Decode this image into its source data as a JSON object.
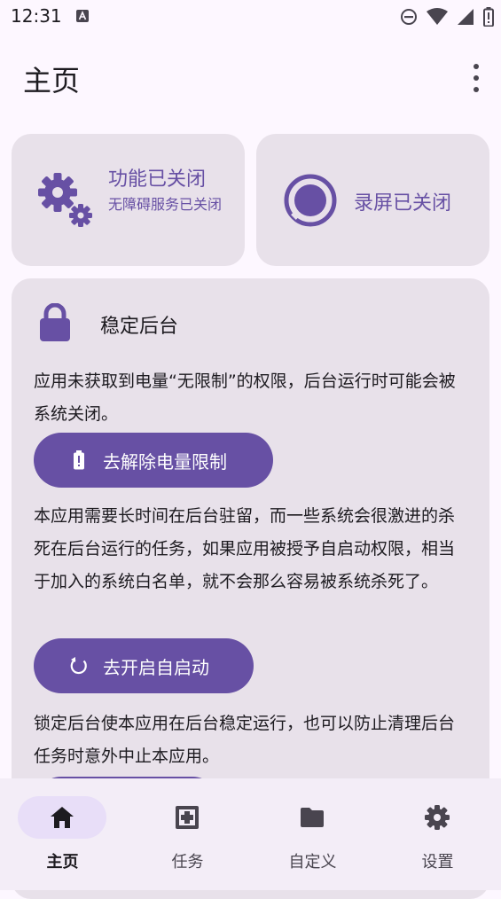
{
  "status_bar": {
    "time": "12:31"
  },
  "app_bar": {
    "title": "主页"
  },
  "cards": {
    "function": {
      "title": "功能已关闭",
      "subtitle": "无障碍服务已关闭"
    },
    "record": {
      "title": "录屏已关闭"
    },
    "stable": {
      "title": "稳定后台",
      "para1": "应用未获取到电量“无限制”的权限，后台运行时可能会被系统关闭。",
      "button1": "去解除电量限制",
      "para2": "本应用需要长时间在后台驻留，而一些系统会很激进的杀死在后台运行的任务，如果应用被授予自启动权限，相当于加入的系统白名单，就不会那么容易被系统杀死了。",
      "button2": "去开启自启动",
      "para3": "锁定后台使本应用在后台稳定运行，也可以防止清理后台任务时意外中止本应用。"
    }
  },
  "nav": [
    {
      "label": "主页",
      "icon": "home-icon",
      "active": true
    },
    {
      "label": "任务",
      "icon": "tasks-icon",
      "active": false
    },
    {
      "label": "自定义",
      "icon": "folder-icon",
      "active": false
    },
    {
      "label": "设置",
      "icon": "settings-icon",
      "active": false
    }
  ],
  "colors": {
    "accent": "#6750a4",
    "card": "#e8e1ea",
    "background": "#fdf7ff",
    "nav_indicator": "#e8def8"
  }
}
